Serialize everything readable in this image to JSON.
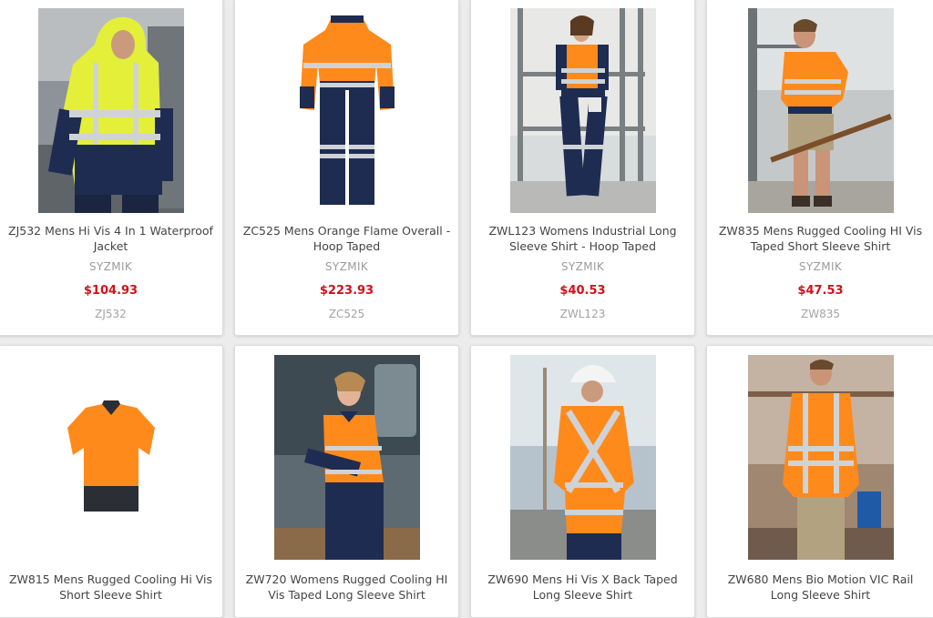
{
  "colors": {
    "price": "#d0121b",
    "hivis_orange": "#ff8a1c",
    "hivis_yellow": "#e4ef3a",
    "navy": "#1f2c52",
    "reflective": "#cfd3d6"
  },
  "products": [
    {
      "title": "ZJ532 Mens Hi Vis 4 In 1 Waterproof Jacket",
      "brand": "SYZMIK",
      "price": "$104.93",
      "sku": "ZJ532"
    },
    {
      "title": "ZC525 Mens Orange Flame Overall - Hoop Taped",
      "brand": "SYZMIK",
      "price": "$223.93",
      "sku": "ZC525"
    },
    {
      "title": "ZWL123 Womens Industrial Long Sleeve Shirt - Hoop Taped",
      "brand": "SYZMIK",
      "price": "$40.53",
      "sku": "ZWL123"
    },
    {
      "title": "ZW835 Mens Rugged Cooling HI Vis Taped Short Sleeve Shirt",
      "brand": "SYZMIK",
      "price": "$47.53",
      "sku": "ZW835"
    },
    {
      "title": "ZW815 Mens Rugged Cooling Hi Vis Short Sleeve Shirt"
    },
    {
      "title": "ZW720 Womens Rugged Cooling HI Vis Taped Long Sleeve Shirt"
    },
    {
      "title": "ZW690 Mens Hi Vis X Back Taped Long Sleeve Shirt"
    },
    {
      "title": "ZW680 Mens Bio Motion VIC Rail Long Sleeve Shirt"
    }
  ]
}
